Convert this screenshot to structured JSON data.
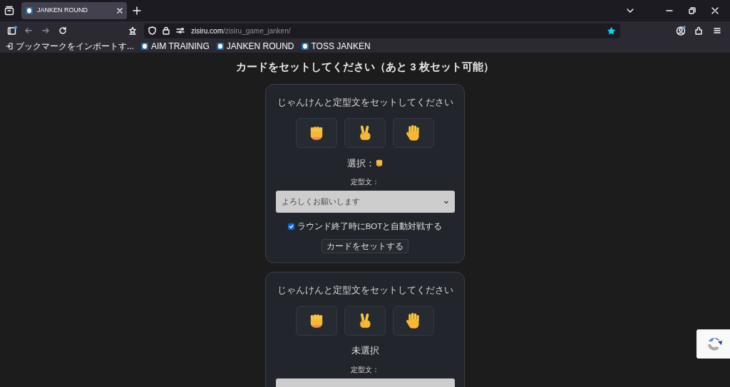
{
  "browser": {
    "tabs": [
      {
        "title": "JANKEN ROUND",
        "selected": true
      }
    ],
    "url": {
      "domain": "zisiru.com",
      "path": "/zisiru_game_janken/"
    },
    "bookmarked": true,
    "bookmarks": [
      {
        "kind": "import",
        "label": "ブックマークをインポートす..."
      },
      {
        "kind": "site",
        "label": "AIM TRAINING"
      },
      {
        "kind": "site",
        "label": "JANKEN ROUND"
      },
      {
        "kind": "site",
        "label": "TOSS JANKEN"
      }
    ]
  },
  "page": {
    "heading": "カードをセットしてください（あと 3 枚セット可能）",
    "cards": [
      {
        "title": "じゃんけんと定型文をセットしてください",
        "hands": [
          {
            "kind": "rock"
          },
          {
            "kind": "scissors"
          },
          {
            "kind": "paper"
          }
        ],
        "status": {
          "label": "選択：",
          "kind": "rock"
        },
        "preset_label": "定型文：",
        "preset_value": "よろしくお願いします",
        "auto_battle": {
          "label": "ラウンド終了時にBOTと自動対戦する",
          "checked": true
        },
        "submit": "カードをセットする"
      },
      {
        "title": "じゃんけんと定型文をセットしてください",
        "hands": [
          {
            "kind": "rock"
          },
          {
            "kind": "scissors"
          },
          {
            "kind": "paper"
          }
        ],
        "status": {
          "label": "未選択"
        },
        "preset_label": "定型文："
      }
    ]
  }
}
